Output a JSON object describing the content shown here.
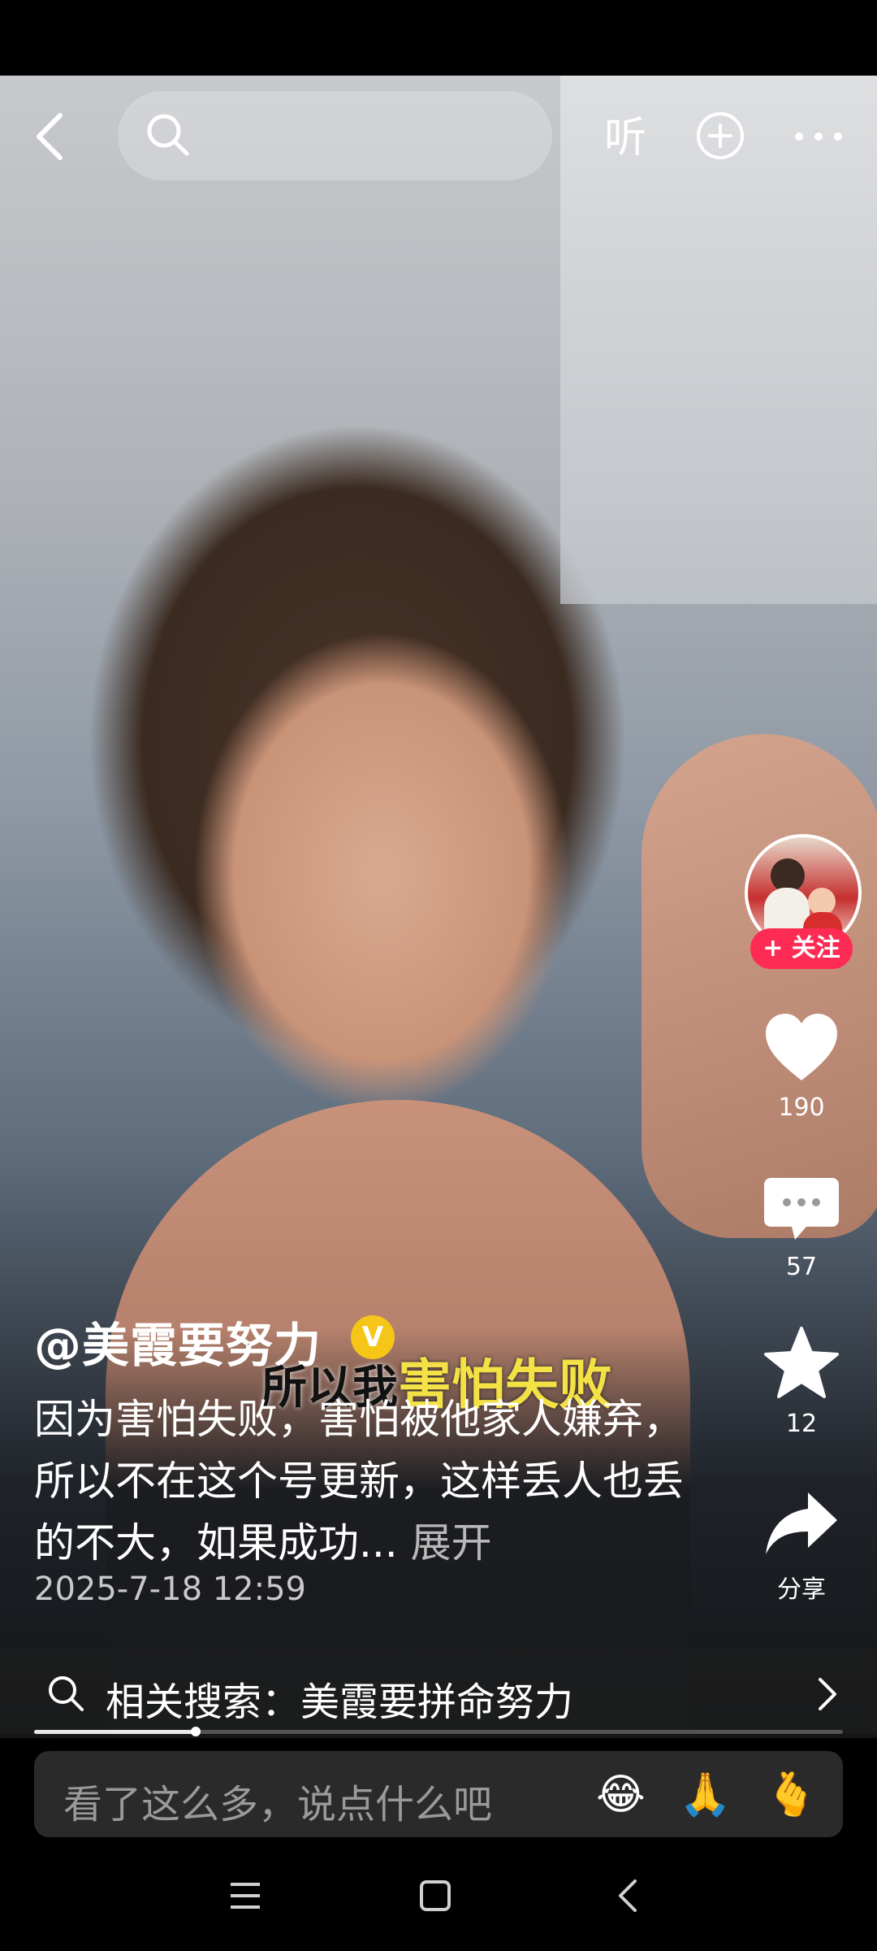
{
  "topbar": {
    "listen_label": "听"
  },
  "rail": {
    "follow_label": "+ 关注",
    "like_count": "190",
    "comment_count": "57",
    "favorite_count": "12",
    "share_label": "分享"
  },
  "post": {
    "author": "@美霞要努力",
    "verified_mark": "V",
    "subtitle_prefix": "所以我",
    "subtitle_highlight": "害怕失败",
    "caption": "因为害怕失败，害怕被他家人嫌弃，所以不在这个号更新，这样丢人也丢的不大，如果成功...",
    "expand_label": "展开",
    "date": "2025-7-18 12:59"
  },
  "related_search": {
    "label": "相关搜索：美霞要拼命努力"
  },
  "progress": {
    "fraction": 0.2
  },
  "comment_bar": {
    "placeholder": "看了这么多，说点什么吧",
    "emojis": [
      "😂",
      "🙏",
      "🫰"
    ]
  },
  "colors": {
    "follow": "#fe2c55",
    "verified": "#f5c518",
    "subtitle_highlight": "#f3e146"
  }
}
